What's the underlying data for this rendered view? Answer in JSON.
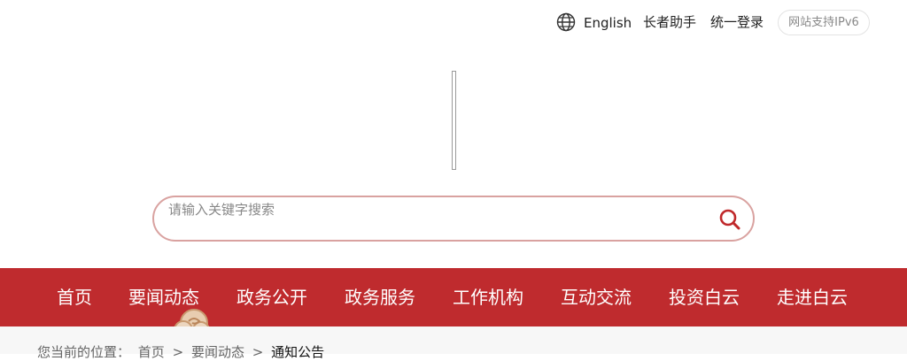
{
  "topbar": {
    "language_label": "English",
    "elder_label": "长者助手",
    "login_label": "统一登录",
    "ipv6_badge": "网站支持IPv6"
  },
  "search": {
    "placeholder": "请输入关键字搜索"
  },
  "nav": {
    "items": [
      {
        "label": "首页"
      },
      {
        "label": "要闻动态"
      },
      {
        "label": "政务公开"
      },
      {
        "label": "政务服务"
      },
      {
        "label": "工作机构"
      },
      {
        "label": "互动交流"
      },
      {
        "label": "投资白云"
      },
      {
        "label": "走进白云"
      }
    ],
    "active_index": 1
  },
  "breadcrumb": {
    "prefix": "您当前的位置：",
    "items": [
      "首页",
      "要闻动态",
      "通知公告"
    ],
    "separator": ">"
  },
  "colors": {
    "nav_background": "#bf2b2e",
    "search_border": "#d9a2a0",
    "icon_red": "#c0292b",
    "cloud_decoration": "#d7b08a"
  },
  "icons": {
    "language": "globe-icon",
    "search": "search-icon",
    "nav_decoration": "cloud-ornament-icon"
  }
}
